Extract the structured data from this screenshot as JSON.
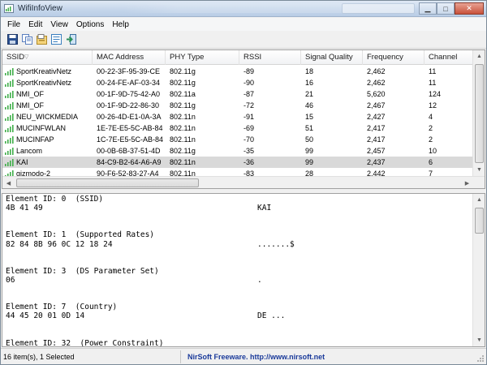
{
  "window": {
    "title": "WifiInfoView"
  },
  "menu": [
    "File",
    "Edit",
    "View",
    "Options",
    "Help"
  ],
  "toolbar": [
    {
      "name": "save-icon",
      "color": "#2a4f8f"
    },
    {
      "name": "copy-icon",
      "color": "#5a7fbf"
    },
    {
      "name": "html-report-icon",
      "color": "#b08a2a"
    },
    {
      "name": "properties-icon",
      "color": "#3a7fbf"
    },
    {
      "name": "exit-icon",
      "color": "#2a8f5a"
    }
  ],
  "table": {
    "columns": [
      "SSID",
      "MAC Address",
      "PHY Type",
      "RSSI",
      "Signal Quality",
      "Frequency",
      "Channel"
    ],
    "rows": [
      [
        "SportKreativNetz",
        "00-22-3F-95-39-CE",
        "802.11g",
        "-89",
        "18",
        "2,462",
        "11"
      ],
      [
        "SportKreativNetz",
        "00-24-FE-AF-03-34",
        "802.11g",
        "-90",
        "16",
        "2,462",
        "11"
      ],
      [
        "NMI_OF",
        "00-1F-9D-75-42-A0",
        "802.11a",
        "-87",
        "21",
        "5,620",
        "124"
      ],
      [
        "NMI_OF",
        "00-1F-9D-22-86-30",
        "802.11g",
        "-72",
        "46",
        "2,467",
        "12"
      ],
      [
        "NEU_WICKMEDIA",
        "00-26-4D-E1-0A-3A",
        "802.11n",
        "-91",
        "15",
        "2,427",
        "4"
      ],
      [
        "MUCINFWLAN",
        "1E-7E-E5-5C-AB-84",
        "802.11n",
        "-69",
        "51",
        "2,417",
        "2"
      ],
      [
        "MUCINFAP",
        "1C-7E-E5-5C-AB-84",
        "802.11n",
        "-70",
        "50",
        "2,417",
        "2"
      ],
      [
        "Lancom",
        "00-0B-6B-37-51-4D",
        "802.11g",
        "-35",
        "99",
        "2,457",
        "10"
      ],
      [
        "KAI",
        "84-C9-B2-64-A6-A9",
        "802.11n",
        "-36",
        "99",
        "2,437",
        "6"
      ],
      [
        "gizmodo-2",
        "90-F6-52-83-27-A4",
        "802.11n",
        "-83",
        "28",
        "2,442",
        "7"
      ]
    ],
    "selected_index": 8
  },
  "details": [
    {
      "title": "Element ID: 0  (SSID)",
      "hex": "4B 41 49",
      "ascii": "KAI"
    },
    {
      "title": "Element ID: 1  (Supported Rates)",
      "hex": "82 84 8B 96 0C 12 18 24",
      "ascii": ".......$"
    },
    {
      "title": "Element ID: 3  (DS Parameter Set)",
      "hex": "06",
      "ascii": "."
    },
    {
      "title": "Element ID: 7  (Country)",
      "hex": "44 45 20 01 0D 14",
      "ascii": "DE ..."
    },
    {
      "title": "Element ID: 32  (Power Constraint)",
      "hex": "",
      "ascii": ""
    }
  ],
  "status": {
    "count": "16 item(s), 1 Selected",
    "link": "NirSoft Freeware.  http://www.nirsoft.net"
  },
  "colors": {
    "selected_row": "#d9d9d9",
    "link": "#1a3a9a",
    "signal_green": "#3fae49"
  }
}
